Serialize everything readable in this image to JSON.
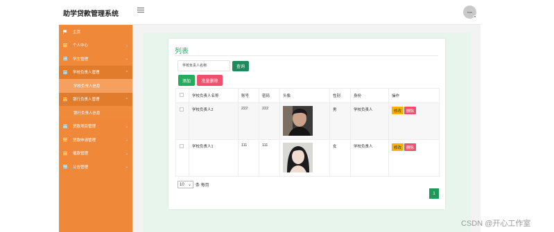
{
  "header": {
    "app_title": "助学贷款管理系统",
    "avatar_text": "lcon"
  },
  "sidebar": {
    "items": [
      {
        "label": "主页"
      },
      {
        "label": "个人中心"
      },
      {
        "label": "学生管理"
      },
      {
        "label": "学校负责人管理"
      },
      {
        "label": "学校负责人信息"
      },
      {
        "label": "银行负责人管理"
      },
      {
        "label": "银行负责人信息"
      },
      {
        "label": "贷款项目管理"
      },
      {
        "label": "贷款申请管理"
      },
      {
        "label": "催款管理"
      },
      {
        "label": "公告管理"
      }
    ]
  },
  "main": {
    "title": "列表",
    "search_placeholder": "学校负责人名称",
    "search_button": "查询",
    "add_button": "添加",
    "batch_delete_button": "批量删除",
    "table": {
      "columns": [
        "学校负责人名称",
        "账号",
        "密码",
        "头像",
        "性别",
        "身份",
        "操作"
      ],
      "rows": [
        {
          "name": "学校负责人2",
          "account": "222",
          "password": "222",
          "gender": "男",
          "role": "学校负责人",
          "edit": "修改",
          "delete": "删除"
        },
        {
          "name": "学校负责人1",
          "account": "111",
          "password": "111",
          "gender": "女",
          "role": "学校负责人",
          "edit": "修改",
          "delete": "删除"
        }
      ]
    },
    "pager": {
      "page_size": "10",
      "per_page_label": "条 每页",
      "current_page": "1"
    }
  },
  "watermark": "CSDN @开心工作室",
  "colors": {
    "sidebar": "#f0883a",
    "accent_green": "#1e8a5e",
    "danger": "#f0506e",
    "warning": "#f5b400",
    "content_bg": "#e8f5ec"
  }
}
